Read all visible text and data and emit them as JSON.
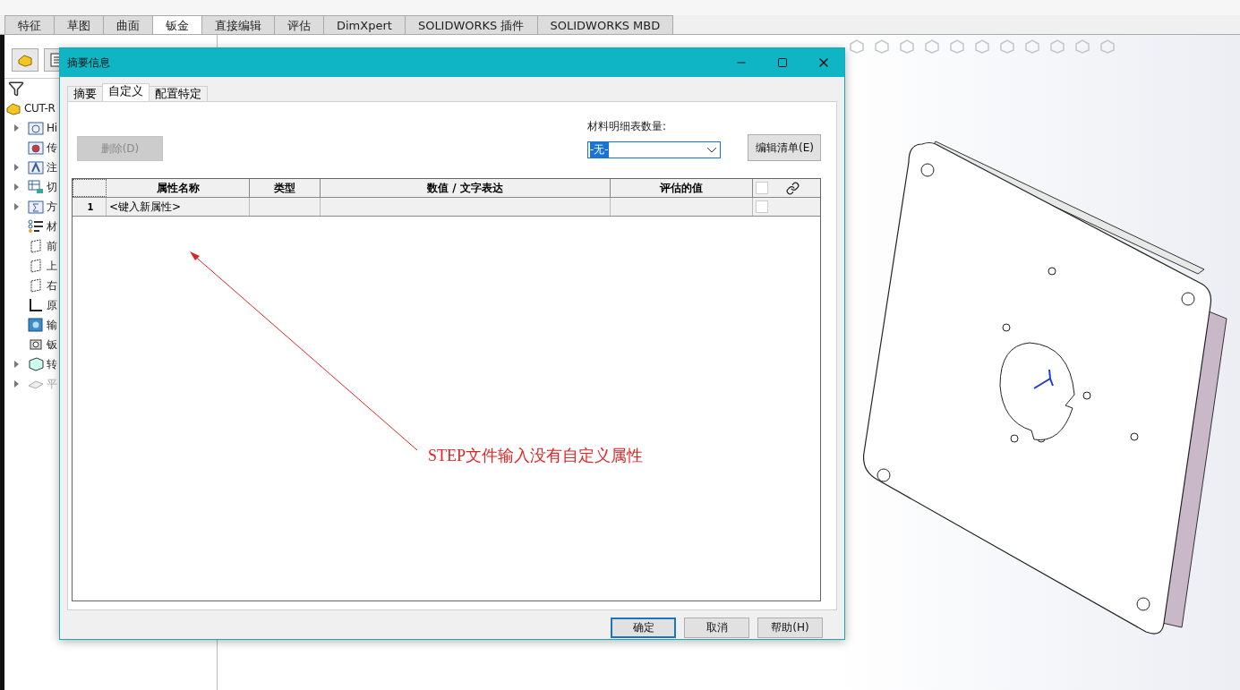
{
  "ribbon_tabs": [
    {
      "label": "特征",
      "selected": false
    },
    {
      "label": "草图",
      "selected": false
    },
    {
      "label": "曲面",
      "selected": false
    },
    {
      "label": "钣金",
      "selected": true
    },
    {
      "label": "直接编辑",
      "selected": false
    },
    {
      "label": "评估",
      "selected": false
    },
    {
      "label": "DimXpert",
      "selected": false
    },
    {
      "label": "SOLIDWORKS 插件",
      "selected": false
    },
    {
      "label": "SOLIDWORKS MBD",
      "selected": false
    }
  ],
  "feature_tree": {
    "root": "CUT-R",
    "items": [
      {
        "kind": "history",
        "label": "Hi",
        "expandable": true,
        "disabled": false
      },
      {
        "kind": "sensor",
        "label": "传",
        "expandable": false,
        "disabled": false
      },
      {
        "kind": "annotation",
        "label": "注",
        "expandable": true,
        "disabled": false
      },
      {
        "kind": "cutlist",
        "label": "切",
        "expandable": true,
        "disabled": false
      },
      {
        "kind": "equation",
        "label": "方",
        "expandable": true,
        "disabled": false
      },
      {
        "kind": "material",
        "label": "材",
        "expandable": false,
        "disabled": false
      },
      {
        "kind": "plane",
        "label": "前",
        "expandable": false,
        "disabled": false
      },
      {
        "kind": "plane",
        "label": "上",
        "expandable": false,
        "disabled": false
      },
      {
        "kind": "plane",
        "label": "右",
        "expandable": false,
        "disabled": false
      },
      {
        "kind": "origin",
        "label": "原",
        "expandable": false,
        "disabled": false
      },
      {
        "kind": "import",
        "label": "输",
        "expandable": false,
        "disabled": false
      },
      {
        "kind": "sheetmetal",
        "label": "钣",
        "expandable": false,
        "disabled": false
      },
      {
        "kind": "convert",
        "label": "转",
        "expandable": true,
        "disabled": false
      },
      {
        "kind": "flat",
        "label": "平",
        "expandable": true,
        "disabled": true
      }
    ]
  },
  "dialog": {
    "title": "摘要信息",
    "tabs": [
      {
        "label": "摘要",
        "selected": false
      },
      {
        "label": "自定义",
        "selected": true
      },
      {
        "label": "配置特定",
        "selected": false
      }
    ],
    "delete_button": {
      "label": "删除(D)",
      "disabled": true
    },
    "bom_quantity_label": "材料明细表数量:",
    "bom_quantity": "-无-",
    "edit_list_button": "编辑清单(E)",
    "table": {
      "columns": [
        "属性名称",
        "类型",
        "数值 / 文字表达",
        "评估的值"
      ],
      "header_checked": false,
      "rows": [
        {
          "number": "1",
          "name": "<键入新属性>",
          "checked": false
        }
      ]
    },
    "buttons": [
      {
        "label": "确定",
        "default": true
      },
      {
        "label": "取消",
        "default": false
      },
      {
        "label": "帮助(H)",
        "default": false
      }
    ]
  },
  "annotation": "STEP文件输入没有自定义属性"
}
